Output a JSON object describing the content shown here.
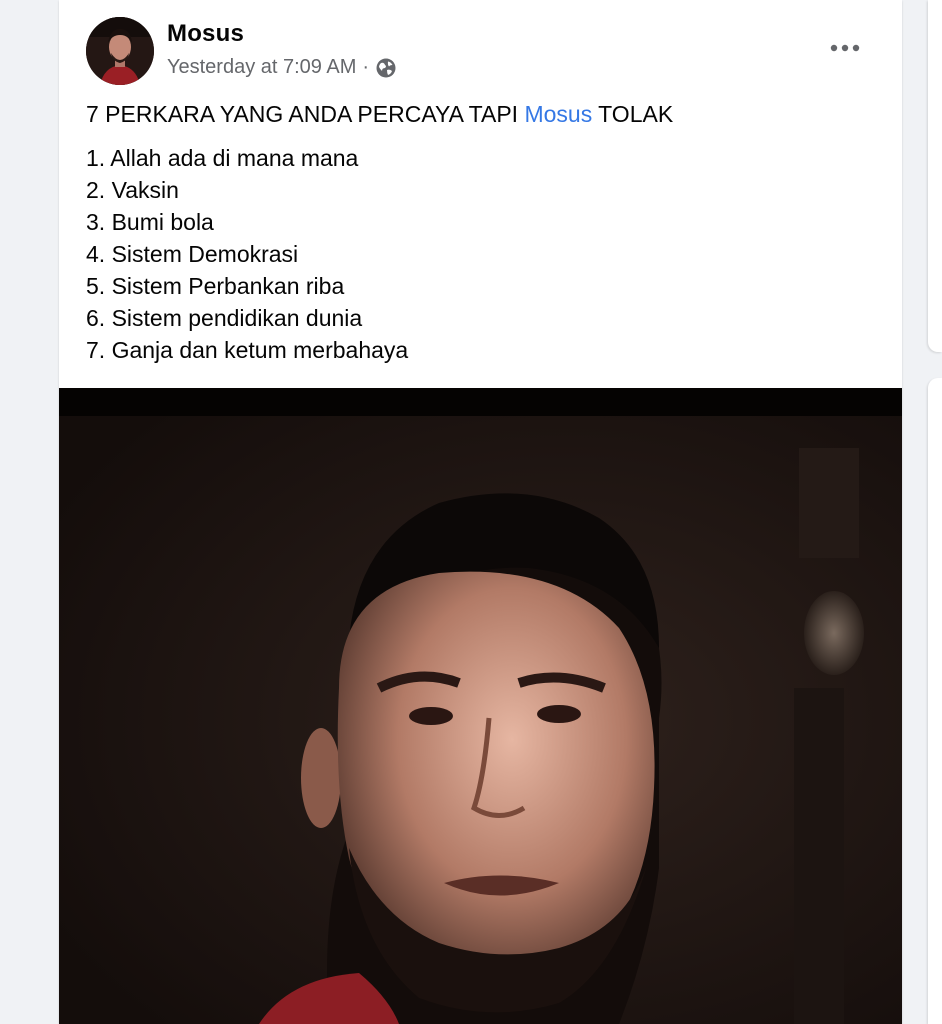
{
  "post": {
    "author": "Mosus",
    "timestamp": "Yesterday at 7:09 AM",
    "separator": "·",
    "audience_icon": "globe-icon",
    "more_icon": "more-options-icon",
    "headline_prefix": "7 PERKARA YANG ANDA PERCAYA TAPI ",
    "headline_mention": "Mosus",
    "headline_suffix": " TOLAK",
    "items": [
      "1. Allah ada di mana mana",
      "2. Vaksin",
      "3. Bumi bola",
      "4. Sistem Demokrasi",
      "5. Sistem Perbankan riba",
      "6. Sistem pendidikan dunia",
      "7. Ganja dan ketum merbahaya"
    ]
  },
  "colors": {
    "background": "#f0f2f5",
    "card": "#ffffff",
    "mention": "#3578e5",
    "secondary_text": "#65676b"
  }
}
